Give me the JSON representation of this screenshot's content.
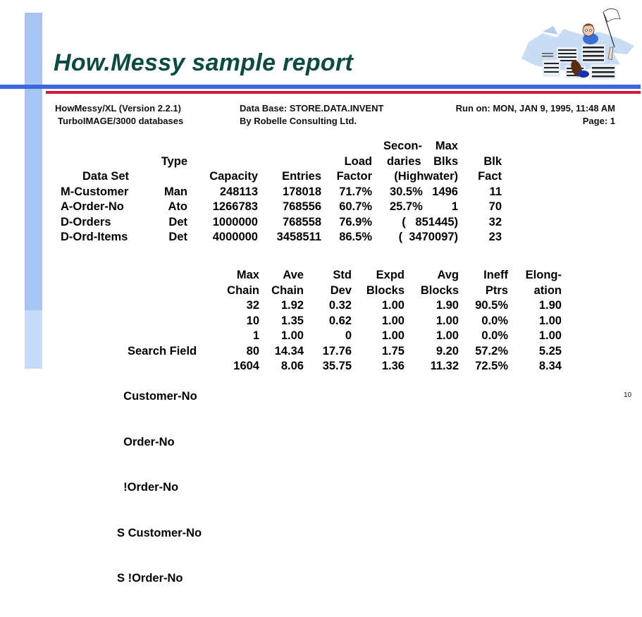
{
  "title": "How.Messy sample report",
  "header": {
    "product": "HowMessy/XL (Version 2.2.1)",
    "platform": "TurboIMAGE/3000 databases",
    "database": "Data Base: STORE.DATA.INVENT",
    "vendor": "By Robelle Consulting Ltd.",
    "run_on": "Run on: MON, JAN 9, 1995, 11:48 AM",
    "page": "Page: 1"
  },
  "dataset_table": {
    "headers": {
      "dataset": [
        "",
        "",
        "Data Set"
      ],
      "type": [
        "",
        "Type",
        ""
      ],
      "capacity": [
        "",
        "",
        "Capacity"
      ],
      "entries": [
        "",
        "",
        "Entries"
      ],
      "load_factor": [
        "",
        "Load",
        "Factor"
      ],
      "secondaries": [
        "Secon-",
        "daries",
        "(Highwater)"
      ],
      "max_blks": [
        "Max",
        "Blks",
        ""
      ],
      "blk_fact": [
        "",
        "Blk",
        "Fact"
      ]
    },
    "rows": [
      {
        "dataset": "M-Customer",
        "type": "Man",
        "capacity": "248113",
        "entries": "178018",
        "load_factor": "71.7%",
        "secondaries": "30.5%",
        "max_blks": "1496",
        "blk_fact": "11"
      },
      {
        "dataset": "A-Order-No",
        "type": "Ato",
        "capacity": "1266783",
        "entries": "768556",
        "load_factor": "60.7%",
        "secondaries": "25.7%",
        "max_blks": "1",
        "blk_fact": "70"
      },
      {
        "dataset": "D-Orders",
        "type": "Det",
        "capacity": "1000000",
        "entries": "768558",
        "load_factor": "76.9%",
        "secondaries": "(   851445)",
        "max_blks": "",
        "blk_fact": "32"
      },
      {
        "dataset": "D-Ord-Items",
        "type": "Det",
        "capacity": "4000000",
        "entries": "3458511",
        "load_factor": "86.5%",
        "secondaries": "(  3470097)",
        "max_blks": "",
        "blk_fact": "23"
      }
    ]
  },
  "search_table": {
    "headers": {
      "search_field": [
        "",
        "Search Field"
      ],
      "max_chain": [
        "Max",
        "Chain"
      ],
      "ave_chain": [
        "Ave",
        "Chain"
      ],
      "std_dev": [
        "Std",
        "Dev"
      ],
      "expd_blocks": [
        "Expd",
        "Blocks"
      ],
      "avg_blocks": [
        "Avg",
        "Blocks"
      ],
      "ineff_ptrs": [
        "Ineff",
        "Ptrs"
      ],
      "elongation": [
        "Elong-",
        "ation"
      ]
    },
    "rows": [
      {
        "search_field": "  Customer-No",
        "max_chain": "32",
        "ave_chain": "1.92",
        "std_dev": "0.32",
        "expd_blocks": "1.00",
        "avg_blocks": "1.90",
        "ineff_ptrs": "90.5%",
        "elongation": "1.90"
      },
      {
        "search_field": "  Order-No",
        "max_chain": "10",
        "ave_chain": "1.35",
        "std_dev": "0.62",
        "expd_blocks": "1.00",
        "avg_blocks": "1.00",
        "ineff_ptrs": "0.0%",
        "elongation": "1.00"
      },
      {
        "search_field": "  !Order-No",
        "max_chain": "1",
        "ave_chain": "1.00",
        "std_dev": "0",
        "expd_blocks": "1.00",
        "avg_blocks": "1.00",
        "ineff_ptrs": "0.0%",
        "elongation": "1.00"
      },
      {
        "search_field": "S Customer-No",
        "max_chain": "80",
        "ave_chain": "14.34",
        "std_dev": "17.76",
        "expd_blocks": "1.75",
        "avg_blocks": "9.20",
        "ineff_ptrs": "57.2%",
        "elongation": "5.25"
      },
      {
        "search_field": "S !Order-No",
        "max_chain": "1604",
        "ave_chain": "8.06",
        "std_dev": "35.75",
        "expd_blocks": "1.36",
        "avg_blocks": "11.32",
        "ineff_ptrs": "72.5%",
        "elongation": "8.34"
      }
    ]
  },
  "slide_number": "10",
  "colors": {
    "title": "#0d4a44",
    "accent_bar": "#a8c4f4",
    "rule_blue": "#3d68dc",
    "rule_red": "#d11a3a"
  },
  "clipart": "person-waving-white-flag-over-paper-stacks"
}
